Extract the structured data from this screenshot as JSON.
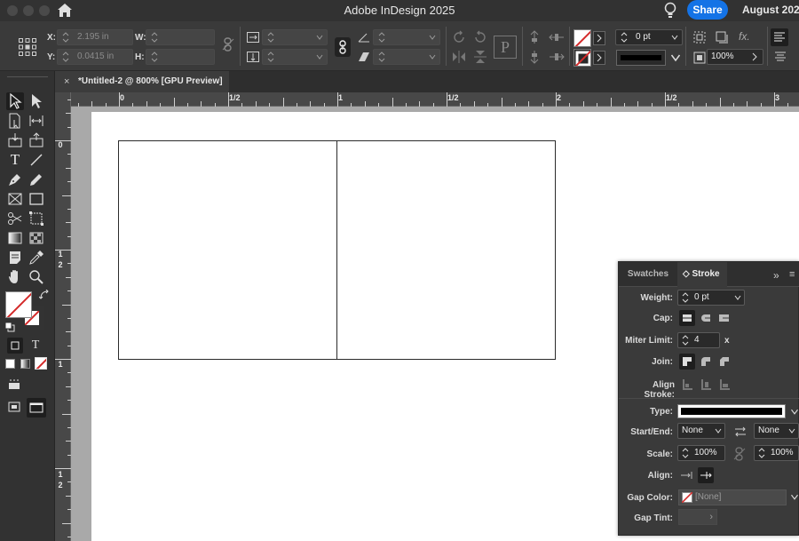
{
  "app": {
    "title": "Adobe InDesign 2025",
    "share_label": "Share",
    "date_text": "August 202"
  },
  "control_panel": {
    "x_label": "X:",
    "x_value": "2.195 in",
    "y_label": "Y:",
    "y_value": "0.0415 in",
    "w_label": "W:",
    "h_label": "H:",
    "stroke_weight": "0 pt",
    "zoom_value": "100%",
    "fx_label": "fx.",
    "p_glyph": "P"
  },
  "document_tab": {
    "close_glyph": "×",
    "label": "*Untitled-2 @ 800% [GPU Preview]"
  },
  "rulers": {
    "horizontal": [
      "0",
      "1/2",
      "1",
      "1/2",
      "2",
      "1/2",
      "3"
    ],
    "vertical": [
      "0",
      "1",
      "2",
      "1",
      "1",
      "2"
    ]
  },
  "toolbox": {
    "type_tool_glyph": "T",
    "text_mode_glyph": "T",
    "fill_color": "#ffffff",
    "stroke_color": "#333333"
  },
  "stroke_panel": {
    "tab_swatches": "Swatches",
    "tab_stroke": "◇ Stroke",
    "collapse_glyph": "»",
    "menu_glyph": "≡",
    "weight_label": "Weight:",
    "weight_value": "0 pt",
    "cap_label": "Cap:",
    "miter_label": "Miter Limit:",
    "miter_value": "4",
    "miter_unit": "x",
    "join_label": "Join:",
    "align_stroke_label": "Align Stroke:",
    "type_label": "Type:",
    "start_end_label": "Start/End:",
    "start_value": "None",
    "end_value": "None",
    "scale_label": "Scale:",
    "scale_start": "100%",
    "scale_end": "100%",
    "align_label": "Align:",
    "gap_color_label": "Gap Color:",
    "gap_color_value": "[None]",
    "gap_tint_label": "Gap Tint:",
    "gap_tint_arrow": "›"
  },
  "colors": {
    "accent": "#1473e6",
    "none_slash": "#d42a2a"
  }
}
